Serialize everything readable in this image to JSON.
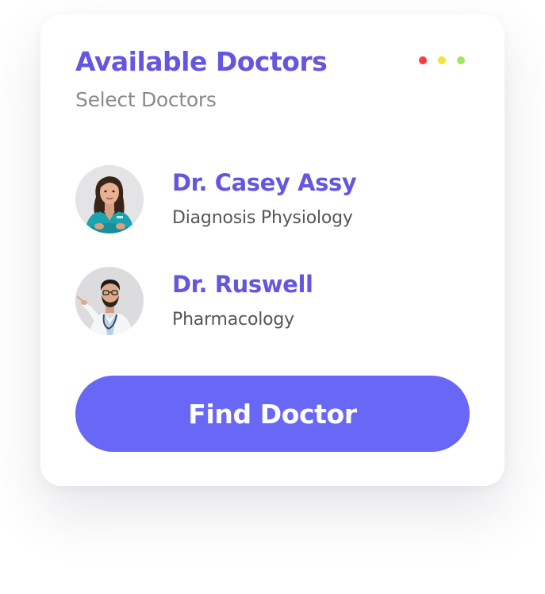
{
  "header": {
    "title": "Available Doctors",
    "subtitle": "Select Doctors"
  },
  "window_dots": [
    {
      "name": "red",
      "color": "#ff3b3b"
    },
    {
      "name": "yellow",
      "color": "#f2e23a"
    },
    {
      "name": "green",
      "color": "#9be85c"
    }
  ],
  "doctors": [
    {
      "name": "Dr. Casey Assy",
      "specialty": "Diagnosis Physiology",
      "avatar_icon": "doctor-avatar-female"
    },
    {
      "name": "Dr. Ruswell",
      "specialty": "Pharmacology",
      "avatar_icon": "doctor-avatar-male"
    }
  ],
  "actions": {
    "find_label": "Find Doctor"
  },
  "colors": {
    "accent": "#6556e0",
    "button": "#6967f6",
    "subtitle": "#8b8b8b",
    "specialty": "#565656"
  }
}
